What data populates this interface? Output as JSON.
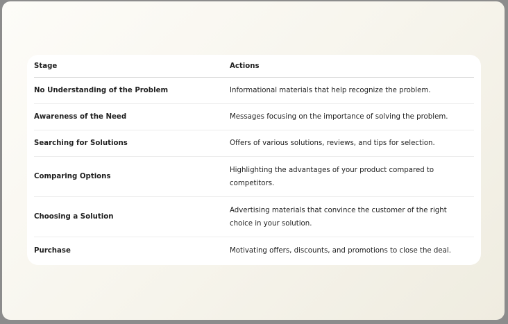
{
  "table": {
    "headers": [
      "Stage",
      "Actions"
    ],
    "rows": [
      {
        "stage": "No Understanding of the Problem",
        "action": "Informational materials that help recognize the problem."
      },
      {
        "stage": "Awareness of the Need",
        "action": "Messages focusing on the importance of solving the problem."
      },
      {
        "stage": "Searching for Solutions",
        "action": "Offers of various solutions, reviews, and tips for selection."
      },
      {
        "stage": "Comparing Options",
        "action": "Highlighting the advantages of your product compared to competitors."
      },
      {
        "stage": "Choosing a Solution",
        "action": "Advertising materials that convince the customer of the right choice in your solution."
      },
      {
        "stage": "Purchase",
        "action": "Motivating offers, discounts, and promotions to close the deal."
      }
    ]
  }
}
